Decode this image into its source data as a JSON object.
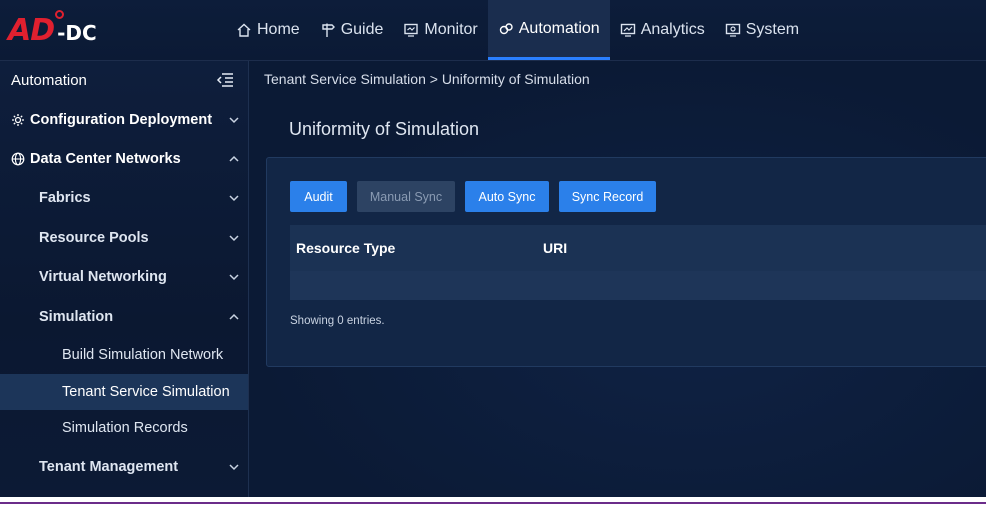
{
  "brand": {
    "logo_main": "AD",
    "logo_suffix": "-DC"
  },
  "nav": {
    "items": [
      {
        "label": "Home",
        "icon": "home-icon"
      },
      {
        "label": "Guide",
        "icon": "signpost-icon"
      },
      {
        "label": "Monitor",
        "icon": "monitor-icon"
      },
      {
        "label": "Automation",
        "icon": "automation-icon",
        "active": true
      },
      {
        "label": "Analytics",
        "icon": "analytics-icon"
      },
      {
        "label": "System",
        "icon": "system-icon"
      }
    ]
  },
  "sidebar": {
    "title": "Automation",
    "items": [
      {
        "label": "Configuration Deployment",
        "icon": "settings-icon",
        "expanded": false
      },
      {
        "label": "Data Center Networks",
        "icon": "globe-icon",
        "expanded": true
      },
      {
        "label": "Fabrics",
        "expanded": false
      },
      {
        "label": "Resource Pools",
        "expanded": false
      },
      {
        "label": "Virtual Networking",
        "expanded": false
      },
      {
        "label": "Simulation",
        "expanded": true
      },
      {
        "label": "Build Simulation Network"
      },
      {
        "label": "Tenant Service Simulation",
        "active": true
      },
      {
        "label": "Simulation Records"
      },
      {
        "label": "Tenant Management",
        "expanded": false
      }
    ]
  },
  "main": {
    "breadcrumb": "Tenant Service Simulation > Uniformity of Simulation",
    "title": "Uniformity of Simulation",
    "buttons": {
      "audit": "Audit",
      "manual_sync": "Manual Sync",
      "auto_sync": "Auto Sync",
      "sync_record": "Sync Record"
    },
    "table": {
      "columns": [
        "Resource Type",
        "URI"
      ]
    },
    "showing": "Showing 0 entries."
  },
  "colors": {
    "accent": "#2b80ea",
    "brand_red": "#e0202f",
    "active_nav_underline": "#2a7fff"
  }
}
